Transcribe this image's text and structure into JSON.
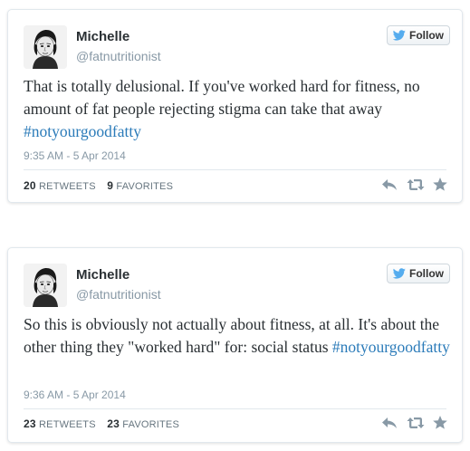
{
  "colors": {
    "hashtag": "#2b7bb9",
    "name": "#292f33",
    "meta": "#8899a6",
    "icon": "#8899a6",
    "follow_bird": "#55acee"
  },
  "tweets": [
    {
      "author_name": "Michelle",
      "handle": "@fatnutritionist",
      "follow_label": "Follow",
      "text_plain": "That is totally delusional. If you've worked hard for fitness, no amount of fat people rejecting stigma can take that away ",
      "hashtag": "#notyourgoodfatty",
      "timestamp": "9:35 AM - 5 Apr 2014",
      "retweets_count": "20",
      "retweets_label": "RETWEETS",
      "favorites_count": "9",
      "favorites_label": "FAVORITES",
      "icons": [
        "reply-icon",
        "retweet-icon",
        "favorite-icon"
      ]
    },
    {
      "author_name": "Michelle",
      "handle": "@fatnutritionist",
      "follow_label": "Follow",
      "text_plain": "So this is obviously not actually about fitness, at all. It's about the other thing they \"worked hard\" for: social status ",
      "hashtag": "#notyourgoodfatty",
      "timestamp": "9:36 AM - 5 Apr 2014",
      "retweets_count": "23",
      "retweets_label": "RETWEETS",
      "favorites_count": "23",
      "favorites_label": "FAVORITES",
      "icons": [
        "reply-icon",
        "retweet-icon",
        "favorite-icon"
      ]
    }
  ]
}
